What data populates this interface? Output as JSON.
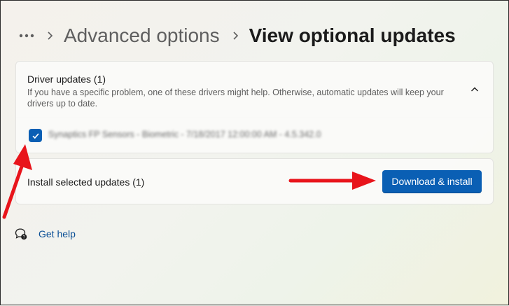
{
  "breadcrumb": {
    "more_icon": "more-horizontal-icon",
    "separator_icon": "chevron-right-icon",
    "parent": "Advanced options",
    "current": "View optional updates"
  },
  "driver_updates": {
    "title": "Driver updates (1)",
    "description": "If you have a specific problem, one of these drivers might help. Otherwise, automatic updates will keep your drivers up to date.",
    "expanded": true,
    "items": [
      {
        "checked": true,
        "name": "Synaptics FP Sensors - Biometric - 7/18/2017 12:00:00 AM - 4.5.342.0"
      }
    ]
  },
  "install": {
    "label": "Install selected updates (1)",
    "button_label": "Download & install"
  },
  "help": {
    "icon": "help-chat-icon",
    "label": "Get help"
  },
  "colors": {
    "accent": "#0a5fb4",
    "annotation": "#e8141b",
    "link": "#0a4f96"
  }
}
